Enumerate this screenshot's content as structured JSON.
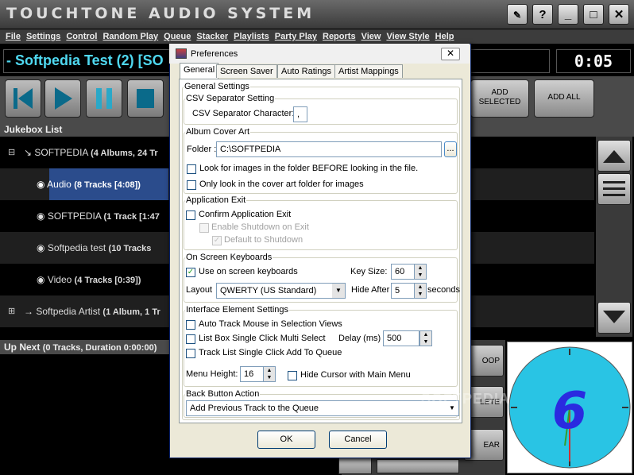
{
  "app": {
    "title": "TOUCHTONE AUDIO SYSTEM",
    "window_buttons": [
      "?",
      "_",
      "□",
      "✕"
    ]
  },
  "menu": [
    "File",
    "Settings",
    "Control",
    "Random Play",
    "Queue",
    "Stacker",
    "Playlists",
    "Party Play",
    "Reports",
    "View",
    "View Style",
    "Help"
  ],
  "now_playing": {
    "title": "- Softpedia Test (2) [SO",
    "time": "0:05"
  },
  "transport": {
    "add_selected": "ADD SELECTED",
    "add_all": "ADD ALL"
  },
  "jukebox": {
    "header": "Jukebox List",
    "items": [
      {
        "name": "SOFTPEDIA",
        "detail": "(4 Albums, 24 Tr"
      },
      {
        "name": "Audio",
        "detail": "(8 Tracks [4:08])"
      },
      {
        "name": "SOFTPEDIA",
        "detail": "(1 Track [1:47"
      },
      {
        "name": "Softpedia test",
        "detail": "(10 Tracks"
      },
      {
        "name": "Video",
        "detail": "(4 Tracks [0:39])"
      },
      {
        "name": "Softpedia Artist",
        "detail": "(1 Album, 1 Tr"
      }
    ]
  },
  "upnext": {
    "label": "Up Next",
    "detail": "(0 Tracks, Duration 0:00:00)"
  },
  "right_buttons": [
    "OOP",
    "LETE",
    "EAR"
  ],
  "clock": {
    "digit": "6"
  },
  "watermark": "SOFTPEDIA",
  "dialog": {
    "title": "Preferences",
    "tabs": [
      "General",
      "Screen Saver",
      "Auto Ratings",
      "Artist Mappings"
    ],
    "general_settings": "General Settings",
    "csv": {
      "group": "CSV Separator Setting",
      "label": "CSV Separator Character:",
      "value": ","
    },
    "album_art": {
      "group": "Album Cover Art",
      "folder_label": "Folder :",
      "folder_value": "C:\\SOFTPEDIA",
      "browse": "...",
      "look_before": "Look for images in the folder BEFORE looking in the file.",
      "only_cover": "Only look in the cover art folder for images"
    },
    "app_exit": {
      "group": "Application Exit",
      "confirm": "Confirm Application Exit",
      "enable_shutdown": "Enable Shutdown on Exit",
      "default_shutdown": "Default to Shutdown"
    },
    "keyboards": {
      "group": "On Screen Keyboards",
      "use": "Use on screen keyboards",
      "key_size_label": "Key Size:",
      "key_size": "60",
      "layout_label": "Layout",
      "layout_value": "QWERTY (US Standard)",
      "hide_after_label": "Hide After",
      "hide_after": "5",
      "seconds": "seconds"
    },
    "interface": {
      "group": "Interface Element Settings",
      "auto_track": "Auto Track Mouse in Selection Views",
      "list_box": "List Box Single Click Multi Select",
      "delay_label": "Delay (ms)",
      "delay": "500",
      "track_list": "Track List Single Click Add To Queue",
      "menu_height_label": "Menu Height:",
      "menu_height": "16",
      "hide_cursor": "Hide Cursor with Main Menu"
    },
    "back": {
      "group": "Back Button Action",
      "value": "Add Previous Track to the Queue"
    },
    "ok": "OK",
    "cancel": "Cancel"
  }
}
